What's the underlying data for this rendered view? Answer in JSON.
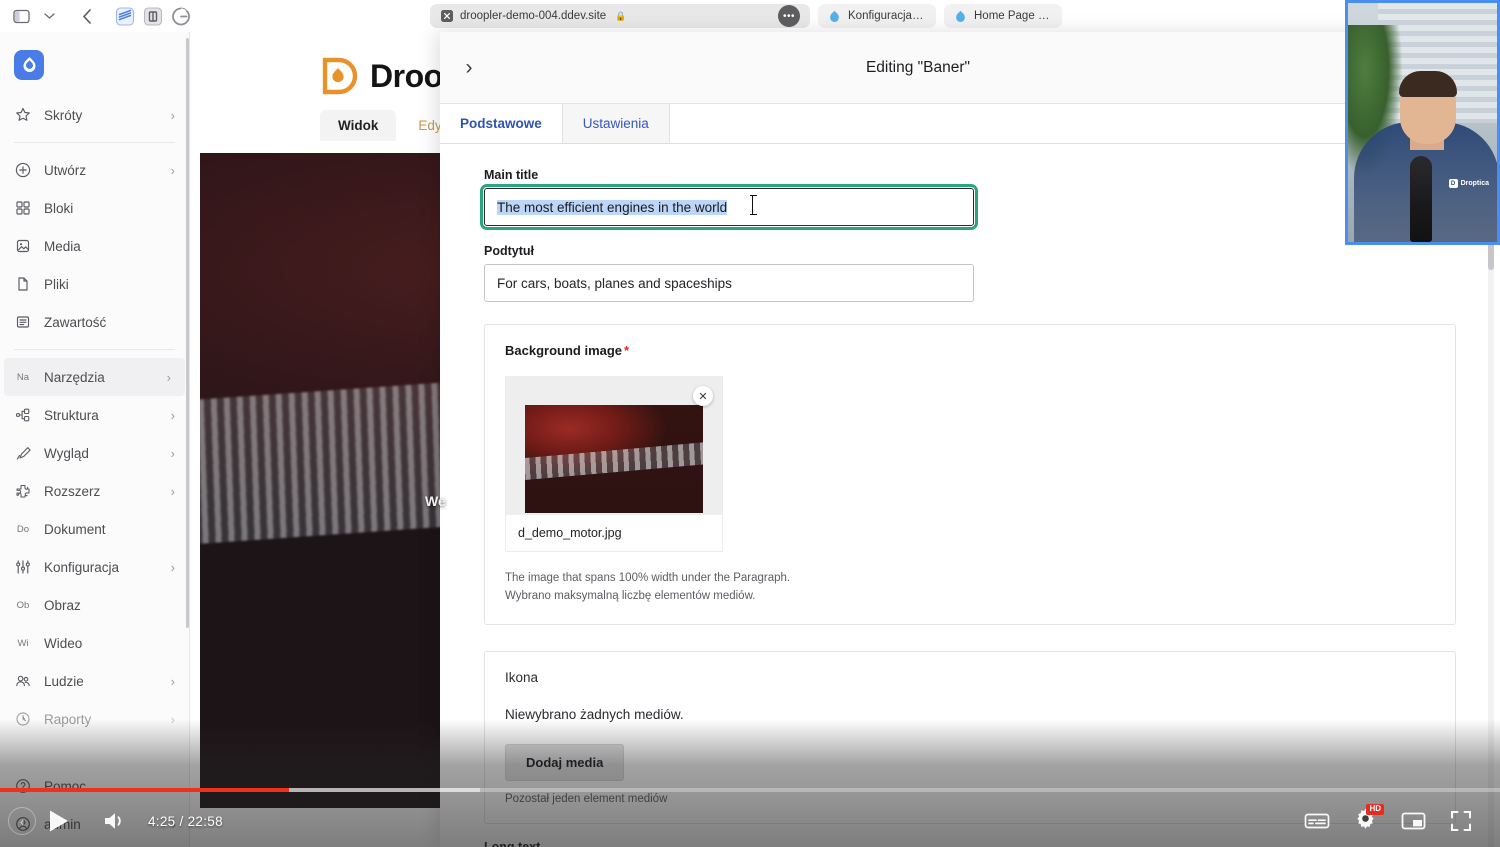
{
  "browser": {
    "toolbar_icons": [
      "sidebar-toggle-icon",
      "chevron-down-icon",
      "back-icon",
      "extension-icon",
      "reader-icon",
      "grammarly-icon"
    ],
    "tabs": [
      {
        "label": "droopler-demo-004.ddev.site",
        "favicon": "close-x-icon",
        "lock": "lock-icon",
        "active": true
      },
      {
        "label": "Konfiguracja | D...",
        "favicon": "drupal-icon",
        "active": false
      },
      {
        "label": "Home Page | Dr...",
        "favicon": "drupal-icon",
        "active": false
      }
    ],
    "overflow_label": "•••"
  },
  "sidebar": {
    "logo_icon": "drupal-logo-icon",
    "groups": [
      {
        "items": [
          {
            "label": "Skróty",
            "icon": "star-icon",
            "chevron": true
          }
        ]
      },
      {
        "items": [
          {
            "label": "Utwórz",
            "icon": "plus-circle-icon",
            "chevron": true
          },
          {
            "label": "Bloki",
            "icon": "blocks-icon",
            "chevron": false
          },
          {
            "label": "Media",
            "icon": "media-icon",
            "chevron": false
          },
          {
            "label": "Pliki",
            "icon": "file-icon",
            "chevron": false
          },
          {
            "label": "Zawartość",
            "icon": "content-icon",
            "chevron": false
          }
        ]
      },
      {
        "items": [
          {
            "label": "Narzędzia",
            "icon": "Na",
            "icon_type": "text",
            "chevron": true,
            "active": true
          },
          {
            "label": "Struktura",
            "icon": "structure-icon",
            "chevron": true
          },
          {
            "label": "Wygląd",
            "icon": "brush-icon",
            "chevron": true
          },
          {
            "label": "Rozszerz",
            "icon": "puzzle-icon",
            "chevron": true
          },
          {
            "label": "Dokument",
            "icon": "Do",
            "icon_type": "text",
            "chevron": false
          },
          {
            "label": "Konfiguracja",
            "icon": "sliders-icon",
            "chevron": true
          },
          {
            "label": "Obraz",
            "icon": "Ob",
            "icon_type": "text",
            "chevron": false
          },
          {
            "label": "Wideo",
            "icon": "Wi",
            "icon_type": "text",
            "chevron": false
          },
          {
            "label": "Ludzie",
            "icon": "people-icon",
            "chevron": true
          },
          {
            "label": "Raporty",
            "icon": "reports-icon",
            "chevron": true
          }
        ]
      }
    ],
    "bottom_items": [
      {
        "label": "Pomoc",
        "icon": "help-circle-icon",
        "chevron": false
      },
      {
        "label": "admin",
        "icon": "user-circle-icon",
        "chevron": true
      }
    ]
  },
  "page": {
    "brand_name": "Droo",
    "tabs": [
      {
        "label": "Widok",
        "active": true
      },
      {
        "label": "Edytuj",
        "active": false
      }
    ],
    "hero_text": "We"
  },
  "modal": {
    "collapse_icon": "chevron-right-icon",
    "title": "Editing \"Baner\"",
    "tabs": [
      {
        "label": "Podstawowe",
        "active": true
      },
      {
        "label": "Ustawienia",
        "active": false
      }
    ],
    "fields": {
      "main_title": {
        "label": "Main title",
        "value": "The most efficient engines in the world",
        "selected": true
      },
      "subtitle": {
        "label": "Podtytuł",
        "value": "For cars, boats, planes and spaceships"
      },
      "background_image": {
        "label": "Background image",
        "required_mark": "*",
        "file_name": "d_demo_motor.jpg",
        "remove_icon": "close-x-icon",
        "help_line_1": "The image that spans 100% width under the Paragraph.",
        "help_line_2": "Wybrano maksymalną liczbę elementów mediów."
      },
      "icon": {
        "label": "Ikona",
        "empty_text": "Niewybrano żadnych mediów.",
        "add_button": "Dodaj media",
        "note": "Pozostał jeden element mediów"
      },
      "long_text": {
        "label": "Long text"
      }
    }
  },
  "player": {
    "play_icon": "play-icon",
    "prev_icon": "previous-icon",
    "volume_icon": "volume-icon",
    "current_time": "4:25",
    "separator": " / ",
    "duration": "22:58",
    "time_display": "4:25 / 22:58",
    "subtitles_icon": "subtitles-icon",
    "settings_icon": "gear-icon",
    "quality_badge": "HD",
    "pip_icon": "picture-in-picture-icon",
    "fullscreen_icon": "fullscreen-icon",
    "progress_percent": 19.3
  },
  "webcam": {
    "shirt_logo": "Droptica",
    "border_color": "#4a8ef0"
  },
  "colors": {
    "drupal_blue": "#4a7ce8",
    "droopler_orange": "#e8922a",
    "tab_link": "#2f53b3",
    "focus_green": "#2aa67e",
    "selection_blue": "#bcd6f7",
    "progress_red": "#f22f1d",
    "required_red": "#d93025"
  }
}
